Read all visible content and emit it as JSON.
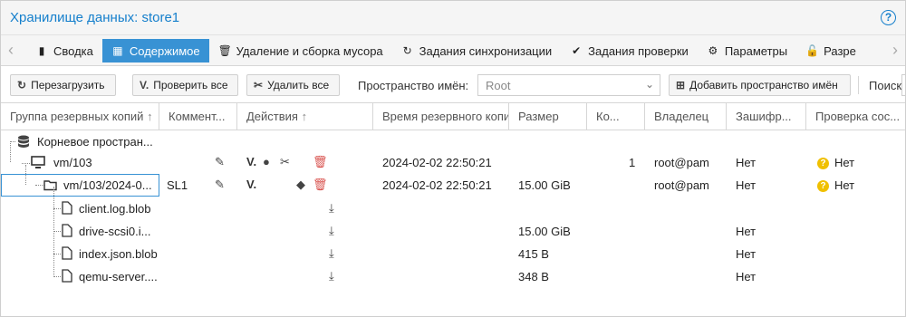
{
  "title": "Хранилище данных: store1",
  "help_symbol": "?",
  "tabs": [
    {
      "label": "Сводка",
      "icon": "book-icon"
    },
    {
      "label": "Содержимое",
      "icon": "grid-icon",
      "active": true
    },
    {
      "label": "Удаление и сборка мусора",
      "icon": "trash-icon"
    },
    {
      "label": "Задания синхронизации",
      "icon": "sync-icon"
    },
    {
      "label": "Задания проверки",
      "icon": "check-circle-icon"
    },
    {
      "label": "Параметры",
      "icon": "gear-icon"
    },
    {
      "label": "Разре",
      "icon": "unlock-icon"
    }
  ],
  "toolbar": {
    "reload": "Перезагрузить",
    "verify_all": "Проверить все",
    "remove_all": "Удалить все",
    "namespace_label": "Пространство имён:",
    "namespace_value": "Root",
    "add_namespace": "Добавить пространство имён",
    "search_label": "Поиск"
  },
  "columns": {
    "group": "Группа резервных копий",
    "comment": "Коммент...",
    "actions": "Действия",
    "time": "Время резервного копи",
    "size": "Размер",
    "count": "Ко...",
    "owner": "Владелец",
    "encrypted": "Зашифр...",
    "verify": "Проверка сос..."
  },
  "rows": {
    "root": {
      "name": "Корневое простран..."
    },
    "group": {
      "name": "vm/103",
      "time": "2024-02-02 22:50:21",
      "count": "1",
      "owner": "root@pam",
      "encrypted": "Нет",
      "verify": "Нет"
    },
    "snapshot": {
      "name": "vm/103/2024-0...",
      "comment": "SL1",
      "time": "2024-02-02 22:50:21",
      "size": "15.00 GiB",
      "owner": "root@pam",
      "encrypted": "Нет",
      "verify": "Нет"
    },
    "files": [
      {
        "name": "client.log.blob",
        "size": "",
        "encrypted": ""
      },
      {
        "name": "drive-scsi0.i...",
        "size": "15.00 GiB",
        "encrypted": "Нет"
      },
      {
        "name": "index.json.blob",
        "size": "415 B",
        "encrypted": "Нет"
      },
      {
        "name": "qemu-server....",
        "size": "348 B",
        "encrypted": "Нет"
      }
    ]
  },
  "colors": {
    "accent": "#157fcc",
    "active_tab": "#3892d4",
    "delete": "#d9534f",
    "warning": "#f0c000"
  }
}
